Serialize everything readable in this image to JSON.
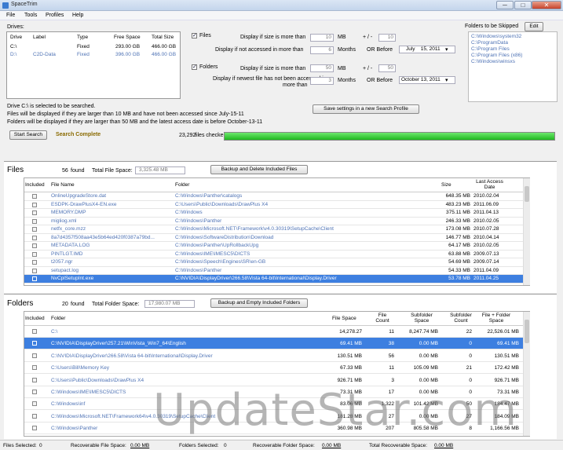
{
  "window": {
    "title": "SpaceTrim",
    "minimize": "─",
    "maximize": "□",
    "close": "✕"
  },
  "menu": [
    "File",
    "Tools",
    "Profiles",
    "Help"
  ],
  "drives": {
    "label": "Drives:",
    "headers": [
      "Drive",
      "Label",
      "Type",
      "Free Space",
      "Total Size"
    ],
    "rows": [
      [
        "C:\\",
        "",
        "Fixed",
        "293.00 GB",
        "466.00 GB"
      ],
      [
        "D:\\",
        "C2D-Data",
        "Fixed",
        "396.00 GB",
        "466.00 GB"
      ]
    ]
  },
  "filters": {
    "files_label": "Files",
    "size_label": "Display if size is more than",
    "size_value": "10",
    "size_unit": "MB",
    "plusminus": "+ / -",
    "pm1": "10",
    "not_accessed_label": "Display if not accessed in more than",
    "not_accessed_value": "6",
    "not_accessed_unit": "Months",
    "or_before": "OR Before",
    "date1_month": "July",
    "date1_day": "15, 2011",
    "folders_label": "Folders",
    "fsize_label": "Display if size is more than",
    "fsize_value": "50",
    "fsize_unit": "MB",
    "pm2": "50",
    "newest_label_1": "Display if newest file has not been accessed in",
    "newest_label_2": "more than",
    "newest_value": "3",
    "newest_unit": "Months",
    "date2": "October  13, 2011",
    "save_button": "Save settings in a new Search Profile"
  },
  "skip": {
    "label": "Folders to be Skipped",
    "edit": "Edit",
    "items": [
      "C:\\Windows\\system32",
      "C:\\ProgramData",
      "C:\\Program Files",
      "C:\\Program Files (x86)",
      "C:\\Windows\\winsxs"
    ]
  },
  "info": [
    "Drive C:\\ is selected to be searched.",
    "Files will be displayed if they are larger than 10 MB and have not been accessed since July-15-11",
    "Folders will be displayed if they are larger than 50 MB and the latest access date is before October-13-11"
  ],
  "search": {
    "button": "Start Search",
    "status": "Search Complete",
    "checked": "23,292",
    "checked_label": "files checked",
    "progress": 1.0
  },
  "files": {
    "title": "Files",
    "found": "56",
    "found_label": "found",
    "total_label": "Total File Space:",
    "total": "3,325.48 MB",
    "button": "Backup and Delete Included Files",
    "headers": [
      "Included",
      "File Name",
      "Folder",
      "Size",
      "Last Access Date"
    ],
    "rows": [
      [
        "OnlineUpgradeStore.dat",
        "C:\\Windows\\Panther\\catalogs",
        "648.35 MB",
        "2010.02.04"
      ],
      [
        "ESDPK-DrawPlusX4-EN.exe",
        "C:\\Users\\Public\\Downloads\\DrawPlus X4",
        "483.23 MB",
        "2011.06.09"
      ],
      [
        "MEMORY.DMP",
        "C:\\Windows",
        "375.11 MB",
        "2011.04.13"
      ],
      [
        "migliog.xml",
        "C:\\Windows\\Panther",
        "246.33 MB",
        "2010.02.05"
      ],
      [
        "netfx_core.mzz",
        "C:\\Windows\\Microsoft.NET\\Framework\\v4.0.30319\\SetupCache\\Client",
        "173.08 MB",
        "2010.07.28"
      ],
      [
        "8a7d4357f508aa43e5b64ed420f0387a79bd...",
        "C:\\Windows\\SoftwareDistribution\\Download",
        "146.77 MB",
        "2010.04.14"
      ],
      [
        "METADATA.LOG",
        "C:\\Windows\\Panther\\UpRollbackUpg",
        "64.17 MB",
        "2010.02.05"
      ],
      [
        "PINTLGT.IMD",
        "C:\\Windows\\IME\\IMESC5\\DICTS",
        "63.88 MB",
        "2009.07.13"
      ],
      [
        "t2057.ngr",
        "C:\\Windows\\Speech\\Engines\\SR\\en-GB",
        "54.69 MB",
        "2009.07.14"
      ],
      [
        "setupact.log",
        "C:\\Windows\\Panther",
        "54.33 MB",
        "2011.04.09"
      ],
      [
        "NvCplSetupInt.exe",
        "C:\\NVIDIA\\DisplayDriver\\266.58\\Vista 64-bit\\International\\Display.Driver",
        "53.78 MB",
        "2011.04.25"
      ]
    ]
  },
  "folders": {
    "title": "Folders",
    "found": "20",
    "found_label": "found",
    "total_label": "Total Folder Space:",
    "total": "17,980.07 MB",
    "button": "Backup and Empty Included Folders",
    "headers": [
      "Included",
      "Folder",
      "File Space",
      "File Count",
      "Subfolder Space",
      "Subfolder Count",
      "File + Folder Space"
    ],
    "rows": [
      [
        "C:\\",
        "14,278.27",
        "11",
        "8,247.74 MB",
        "22",
        "22,526.01 MB"
      ],
      [
        "C:\\NVIDIA\\DisplayDriver\\257.21\\WinVista_Win7_64\\English",
        "69.41 MB",
        "38",
        "0.00 MB",
        "0",
        "69.41 MB"
      ],
      [
        "C:\\NVIDIA\\DisplayDriver\\266.58\\Vista 64-bit\\International\\Display.Driver",
        "130.51 MB",
        "56",
        "0.00 MB",
        "0",
        "130.51 MB"
      ],
      [
        "C:\\Users\\Bill\\Memory Key",
        "67.33 MB",
        "11",
        "105.09 MB",
        "21",
        "172.42 MB"
      ],
      [
        "C:\\Users\\Public\\Downloads\\DrawPlus X4",
        "926.71 MB",
        "3",
        "0.00 MB",
        "0",
        "926.71 MB"
      ],
      [
        "C:\\Windows\\IME\\IMESC5\\DICTS",
        "73.31 MB",
        "17",
        "0.00 MB",
        "0",
        "73.31 MB"
      ],
      [
        "C:\\Windows\\inf",
        "83.06 MB",
        "1,322",
        "101.42 MB",
        "50",
        "184.47 MB"
      ],
      [
        "C:\\Windows\\Microsoft.NET\\Framework64\\v4.0.30319\\SetupCache\\Client",
        "181.28 MB",
        "27",
        "0.00 MB",
        "27",
        "184.09 MB"
      ],
      [
        "C:\\Windows\\Panther",
        "360.98 MB",
        "207",
        "805.58 MB",
        "8",
        "1,166.56 MB"
      ]
    ]
  },
  "status": {
    "files_selected_label": "Files Selected:",
    "files_selected": "0",
    "rec_file_label": "Recoverable File Space:",
    "rec_file": "0.00 MB",
    "folders_selected_label": "Folders Selected:",
    "folders_selected": "0",
    "rec_folder_label": "Recoverable Folder Space:",
    "rec_folder": "0.00 MB",
    "total_rec_label": "Total Recoverable Space:",
    "total_rec": "0.00 MB"
  },
  "watermark": "UpdateStar.com",
  "colors": {
    "selection": "#3d7fe0",
    "link_text": "#4f73b5",
    "progress": "#1fb81f"
  }
}
